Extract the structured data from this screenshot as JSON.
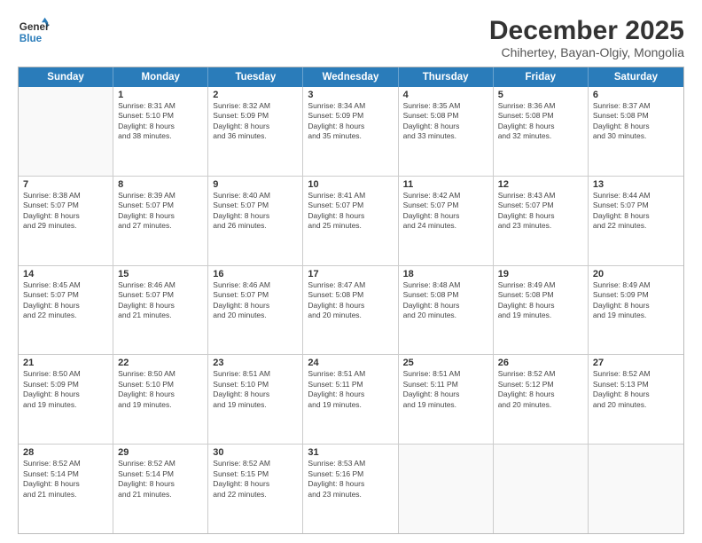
{
  "logo": {
    "general": "General",
    "blue": "Blue"
  },
  "title": "December 2025",
  "location": "Chihertey, Bayan-Olgiy, Mongolia",
  "days_of_week": [
    "Sunday",
    "Monday",
    "Tuesday",
    "Wednesday",
    "Thursday",
    "Friday",
    "Saturday"
  ],
  "weeks": [
    [
      {
        "day": "",
        "lines": []
      },
      {
        "day": "1",
        "lines": [
          "Sunrise: 8:31 AM",
          "Sunset: 5:10 PM",
          "Daylight: 8 hours",
          "and 38 minutes."
        ]
      },
      {
        "day": "2",
        "lines": [
          "Sunrise: 8:32 AM",
          "Sunset: 5:09 PM",
          "Daylight: 8 hours",
          "and 36 minutes."
        ]
      },
      {
        "day": "3",
        "lines": [
          "Sunrise: 8:34 AM",
          "Sunset: 5:09 PM",
          "Daylight: 8 hours",
          "and 35 minutes."
        ]
      },
      {
        "day": "4",
        "lines": [
          "Sunrise: 8:35 AM",
          "Sunset: 5:08 PM",
          "Daylight: 8 hours",
          "and 33 minutes."
        ]
      },
      {
        "day": "5",
        "lines": [
          "Sunrise: 8:36 AM",
          "Sunset: 5:08 PM",
          "Daylight: 8 hours",
          "and 32 minutes."
        ]
      },
      {
        "day": "6",
        "lines": [
          "Sunrise: 8:37 AM",
          "Sunset: 5:08 PM",
          "Daylight: 8 hours",
          "and 30 minutes."
        ]
      }
    ],
    [
      {
        "day": "7",
        "lines": [
          "Sunrise: 8:38 AM",
          "Sunset: 5:07 PM",
          "Daylight: 8 hours",
          "and 29 minutes."
        ]
      },
      {
        "day": "8",
        "lines": [
          "Sunrise: 8:39 AM",
          "Sunset: 5:07 PM",
          "Daylight: 8 hours",
          "and 27 minutes."
        ]
      },
      {
        "day": "9",
        "lines": [
          "Sunrise: 8:40 AM",
          "Sunset: 5:07 PM",
          "Daylight: 8 hours",
          "and 26 minutes."
        ]
      },
      {
        "day": "10",
        "lines": [
          "Sunrise: 8:41 AM",
          "Sunset: 5:07 PM",
          "Daylight: 8 hours",
          "and 25 minutes."
        ]
      },
      {
        "day": "11",
        "lines": [
          "Sunrise: 8:42 AM",
          "Sunset: 5:07 PM",
          "Daylight: 8 hours",
          "and 24 minutes."
        ]
      },
      {
        "day": "12",
        "lines": [
          "Sunrise: 8:43 AM",
          "Sunset: 5:07 PM",
          "Daylight: 8 hours",
          "and 23 minutes."
        ]
      },
      {
        "day": "13",
        "lines": [
          "Sunrise: 8:44 AM",
          "Sunset: 5:07 PM",
          "Daylight: 8 hours",
          "and 22 minutes."
        ]
      }
    ],
    [
      {
        "day": "14",
        "lines": [
          "Sunrise: 8:45 AM",
          "Sunset: 5:07 PM",
          "Daylight: 8 hours",
          "and 22 minutes."
        ]
      },
      {
        "day": "15",
        "lines": [
          "Sunrise: 8:46 AM",
          "Sunset: 5:07 PM",
          "Daylight: 8 hours",
          "and 21 minutes."
        ]
      },
      {
        "day": "16",
        "lines": [
          "Sunrise: 8:46 AM",
          "Sunset: 5:07 PM",
          "Daylight: 8 hours",
          "and 20 minutes."
        ]
      },
      {
        "day": "17",
        "lines": [
          "Sunrise: 8:47 AM",
          "Sunset: 5:08 PM",
          "Daylight: 8 hours",
          "and 20 minutes."
        ]
      },
      {
        "day": "18",
        "lines": [
          "Sunrise: 8:48 AM",
          "Sunset: 5:08 PM",
          "Daylight: 8 hours",
          "and 20 minutes."
        ]
      },
      {
        "day": "19",
        "lines": [
          "Sunrise: 8:49 AM",
          "Sunset: 5:08 PM",
          "Daylight: 8 hours",
          "and 19 minutes."
        ]
      },
      {
        "day": "20",
        "lines": [
          "Sunrise: 8:49 AM",
          "Sunset: 5:09 PM",
          "Daylight: 8 hours",
          "and 19 minutes."
        ]
      }
    ],
    [
      {
        "day": "21",
        "lines": [
          "Sunrise: 8:50 AM",
          "Sunset: 5:09 PM",
          "Daylight: 8 hours",
          "and 19 minutes."
        ]
      },
      {
        "day": "22",
        "lines": [
          "Sunrise: 8:50 AM",
          "Sunset: 5:10 PM",
          "Daylight: 8 hours",
          "and 19 minutes."
        ]
      },
      {
        "day": "23",
        "lines": [
          "Sunrise: 8:51 AM",
          "Sunset: 5:10 PM",
          "Daylight: 8 hours",
          "and 19 minutes."
        ]
      },
      {
        "day": "24",
        "lines": [
          "Sunrise: 8:51 AM",
          "Sunset: 5:11 PM",
          "Daylight: 8 hours",
          "and 19 minutes."
        ]
      },
      {
        "day": "25",
        "lines": [
          "Sunrise: 8:51 AM",
          "Sunset: 5:11 PM",
          "Daylight: 8 hours",
          "and 19 minutes."
        ]
      },
      {
        "day": "26",
        "lines": [
          "Sunrise: 8:52 AM",
          "Sunset: 5:12 PM",
          "Daylight: 8 hours",
          "and 20 minutes."
        ]
      },
      {
        "day": "27",
        "lines": [
          "Sunrise: 8:52 AM",
          "Sunset: 5:13 PM",
          "Daylight: 8 hours",
          "and 20 minutes."
        ]
      }
    ],
    [
      {
        "day": "28",
        "lines": [
          "Sunrise: 8:52 AM",
          "Sunset: 5:14 PM",
          "Daylight: 8 hours",
          "and 21 minutes."
        ]
      },
      {
        "day": "29",
        "lines": [
          "Sunrise: 8:52 AM",
          "Sunset: 5:14 PM",
          "Daylight: 8 hours",
          "and 21 minutes."
        ]
      },
      {
        "day": "30",
        "lines": [
          "Sunrise: 8:52 AM",
          "Sunset: 5:15 PM",
          "Daylight: 8 hours",
          "and 22 minutes."
        ]
      },
      {
        "day": "31",
        "lines": [
          "Sunrise: 8:53 AM",
          "Sunset: 5:16 PM",
          "Daylight: 8 hours",
          "and 23 minutes."
        ]
      },
      {
        "day": "",
        "lines": []
      },
      {
        "day": "",
        "lines": []
      },
      {
        "day": "",
        "lines": []
      }
    ]
  ]
}
